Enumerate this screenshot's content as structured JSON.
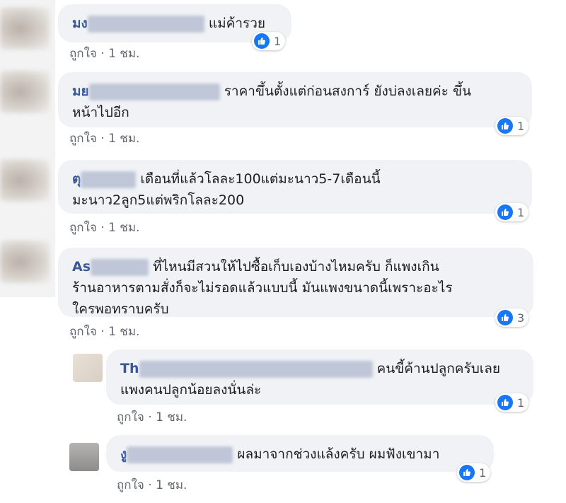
{
  "comments": [
    {
      "name_prefix": "มง",
      "text": "แม่ค้ารวย",
      "meta_like": "ถูกใจ",
      "meta_time": "1 ชม.",
      "reactions": "1"
    },
    {
      "name_prefix": "มย",
      "text_line1": "ราคาขึ้นตั้งแต่ก่อนสงการ์ ยังบ่ลงเลยค่ะ ขึ้น",
      "text_line2": "หน้าไปอีก",
      "meta_like": "ถูกใจ",
      "meta_time": "1 ชม.",
      "reactions": "1"
    },
    {
      "name_prefix": "ตุ",
      "text_line1": "เดือนที่แล้วโลละ100แต่มะนาว5-7เดือนนี้",
      "text_line2": "มะนาว2ลูก5แต่พริกโลละ200",
      "meta_like": "ถูกใจ",
      "meta_time": "1 ชม.",
      "reactions": "1"
    },
    {
      "name_prefix": "As",
      "text_line1": "ที่ไหนมีสวนให้ไปซื้อเก็บเองบ้างไหมครับ ก็แพงเกิน",
      "text_line2": "ร้านอาหารตามสั่งก็จะไม่รอดแล้วแบบนี้ มันแพงขนาดนี้เพราะอะไร",
      "text_line3": "ใครพอทราบครับ",
      "meta_like": "ถูกใจ",
      "meta_time": "1 ชม.",
      "reactions": "3"
    }
  ],
  "replies": [
    {
      "name_prefix": "Th",
      "text_line1": "คนขี้ค้านปลูกครับเลย",
      "text_line2": "แพงคนปลูกน้อยลงนั่นล่ะ",
      "meta_like": "ถูกใจ",
      "meta_time": "1 ชม.",
      "reactions": "1"
    },
    {
      "name_prefix": "งู",
      "text_line1": "ผลมาจากช่วงแล้งครับ ผมฟังเขามา",
      "meta_like": "ถูกใจ",
      "meta_time": "1 ชม.",
      "reactions": "1"
    }
  ],
  "separator": "·",
  "icons": {
    "like": "thumbs-up-icon"
  },
  "colors": {
    "name": "#385898",
    "bubble": "#f0f2f5",
    "like_blue": "#1877f2",
    "meta": "#606770"
  }
}
